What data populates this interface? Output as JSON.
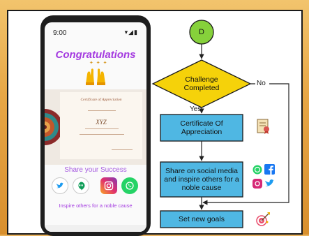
{
  "phone": {
    "time": "9:00",
    "status_icons": "▾◢▮",
    "title": "Congratulations",
    "certificate_title": "Certificate of Appreciation",
    "certificate_name": "XYZ",
    "share_heading": "Share your Success",
    "inspire_text": "Inspire others for a noble cause",
    "social": [
      {
        "icon": "twitter-icon",
        "color": "#1d9bf0"
      },
      {
        "icon": "hangouts-icon",
        "color": "#0f9d58"
      },
      {
        "icon": "instagram-icon",
        "color": "#d62976"
      },
      {
        "icon": "whatsapp-icon",
        "color": "#25d366"
      }
    ]
  },
  "flowchart": {
    "connector_label": "D",
    "decision_label": "Challenge Completed",
    "yes_label": "Yes",
    "no_label": "No",
    "steps": [
      {
        "label": "Certificate Of Appreciation",
        "icon": "certificate-icon"
      },
      {
        "label": "Share on social media and inspire others for a noble cause",
        "icon": "social-media-icons"
      },
      {
        "label": "Set new goals",
        "icon": "goals-icon"
      }
    ]
  },
  "colors": {
    "connector_fill": "#86d13b",
    "decision_fill": "#f5d20a",
    "step_fill": "#4fb7e3",
    "accent_purple": "#a43be0",
    "frame_orange": "#e7a746"
  }
}
